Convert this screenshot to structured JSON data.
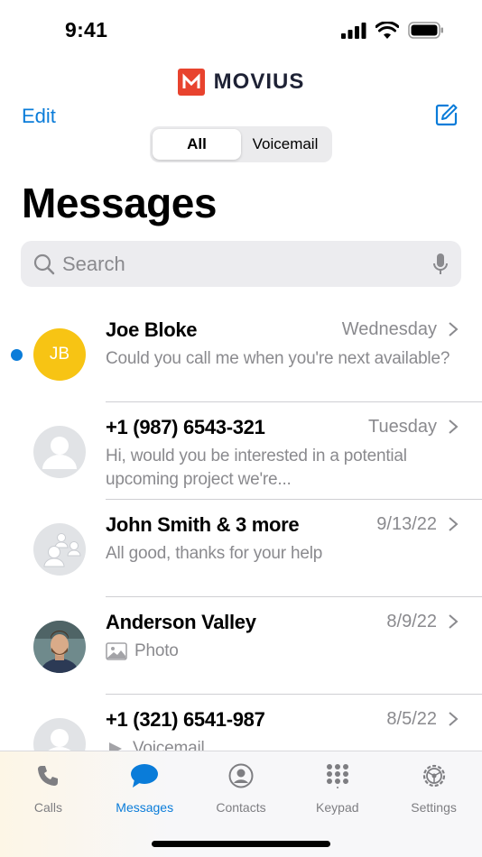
{
  "status_bar": {
    "time": "9:41"
  },
  "brand": {
    "name": "MOVIUS",
    "color": "#e8432e"
  },
  "nav": {
    "edit_label": "Edit",
    "compose_icon": "compose-icon"
  },
  "segments": [
    {
      "label": "All",
      "active": true
    },
    {
      "label": "Voicemail",
      "active": false
    }
  ],
  "page": {
    "title": "Messages"
  },
  "search": {
    "placeholder": "Search"
  },
  "conversations": [
    {
      "name": "Joe Bloke",
      "date": "Wednesday",
      "preview": "Could you call me when you're next available?",
      "avatar": "JB",
      "unread": true
    },
    {
      "name": "+1 (987) 6543-321",
      "date": "Tuesday",
      "preview": "Hi, would you be interested in a potential upcoming project we're...",
      "avatar": "person-icon",
      "unread": false
    },
    {
      "name": "John Smith & 3 more",
      "date": "9/13/22",
      "preview": "All good, thanks for your help",
      "avatar": "group-icon",
      "unread": false
    },
    {
      "name": "Anderson Valley",
      "date": "8/9/22",
      "preview": "Photo",
      "avatar": "photo",
      "unread": false
    },
    {
      "name": "+1 (321) 6541-987",
      "date": "8/5/22",
      "preview": "Voicemail",
      "avatar": "person-icon",
      "unread": false
    }
  ],
  "tabs": [
    {
      "label": "Calls",
      "icon": "phone-icon",
      "active": false
    },
    {
      "label": "Messages",
      "icon": "chat-bubble-icon",
      "active": true
    },
    {
      "label": "Contacts",
      "icon": "contact-icon",
      "active": false
    },
    {
      "label": "Keypad",
      "icon": "keypad-icon",
      "active": false
    },
    {
      "label": "Settings",
      "icon": "settings-icon",
      "active": false
    }
  ],
  "colors": {
    "accent": "#0a7cd9",
    "unread": "#0a7cd9",
    "avatar_initials_bg": "#f7c414"
  }
}
